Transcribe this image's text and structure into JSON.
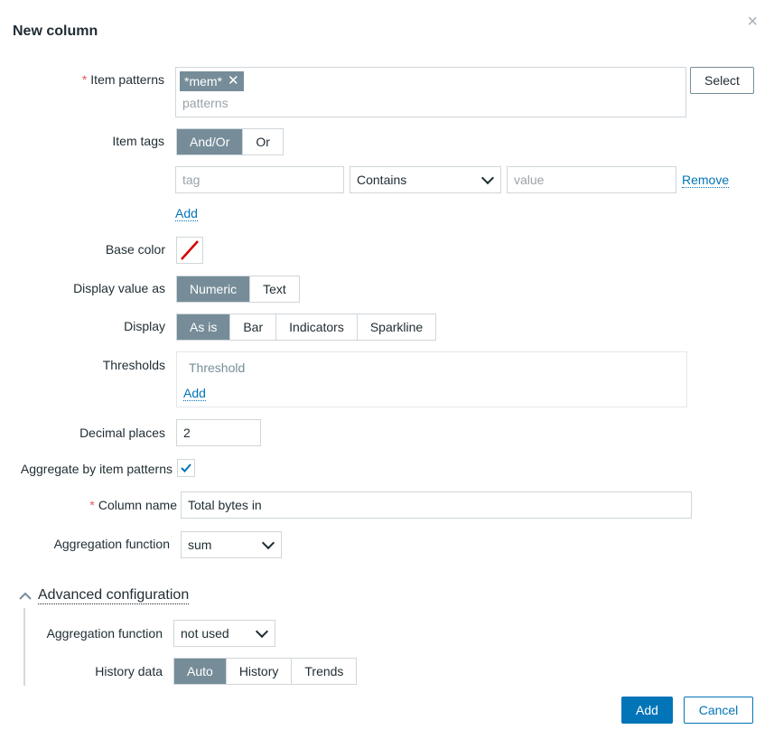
{
  "dialog": {
    "title": "New column",
    "close_glyph": "×"
  },
  "item_patterns": {
    "label": "Item patterns",
    "tag_value": "*mem*",
    "placeholder": "patterns",
    "select_label": "Select"
  },
  "item_tags": {
    "label": "Item tags",
    "options": [
      "And/Or",
      "Or"
    ],
    "selected": "And/Or",
    "row": {
      "tag_placeholder": "tag",
      "operator": "Contains",
      "value_placeholder": "value",
      "remove_label": "Remove"
    },
    "add_label": "Add"
  },
  "base_color": {
    "label": "Base color",
    "icon": "no-color-icon"
  },
  "display_value_as": {
    "label": "Display value as",
    "options": [
      "Numeric",
      "Text"
    ],
    "selected": "Numeric"
  },
  "display": {
    "label": "Display",
    "options": [
      "As is",
      "Bar",
      "Indicators",
      "Sparkline"
    ],
    "selected": "As is"
  },
  "thresholds": {
    "label": "Thresholds",
    "header": "Threshold",
    "add_label": "Add"
  },
  "decimal_places": {
    "label": "Decimal places",
    "value": "2"
  },
  "aggregate": {
    "label": "Aggregate by item patterns",
    "checked": true
  },
  "column_name": {
    "label": "Column name",
    "value": "Total bytes in"
  },
  "aggregation_function": {
    "label": "Aggregation function",
    "value": "sum"
  },
  "advanced": {
    "title": "Advanced configuration",
    "aggregation_function": {
      "label": "Aggregation function",
      "value": "not used"
    },
    "history_data": {
      "label": "History data",
      "options": [
        "Auto",
        "History",
        "Trends"
      ],
      "selected": "Auto"
    }
  },
  "footer": {
    "add_label": "Add",
    "cancel_label": "Cancel"
  },
  "colors": {
    "accent": "#0275b8",
    "selected_segment": "#768d99",
    "required": "#e45959"
  }
}
